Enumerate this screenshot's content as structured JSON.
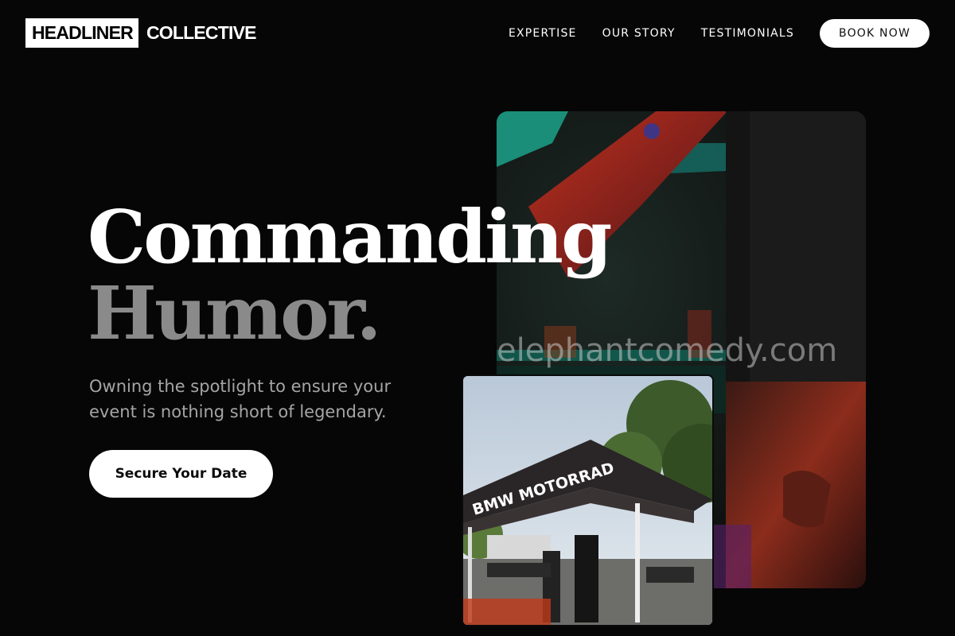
{
  "brand": {
    "logo_boxed": "HEADLINER",
    "logo_rest": "COLLECTIVE"
  },
  "nav": {
    "links": [
      {
        "label": "EXPERTISE"
      },
      {
        "label": "OUR STORY"
      },
      {
        "label": "TESTIMONIALS"
      }
    ],
    "cta_label": "BOOK NOW"
  },
  "hero": {
    "headline_line1": "Commanding",
    "headline_line2": "Humor.",
    "subtext": "Owning the spotlight to ensure your event is nothing short of legendary.",
    "cta_label": "Secure Your Date"
  },
  "images": {
    "large_alt": "performer on stage under colored lights",
    "small_alt": "BMW Motorrad tent at an outdoor event",
    "tent_text": "BMW MOTORRAD",
    "watermark": "elephantcomedy.com"
  },
  "colors": {
    "background": "#060606",
    "headline_primary": "#ffffff",
    "headline_secondary": "#8a8a8a",
    "subtext": "#a5a5a5",
    "button_bg": "#ffffff"
  }
}
